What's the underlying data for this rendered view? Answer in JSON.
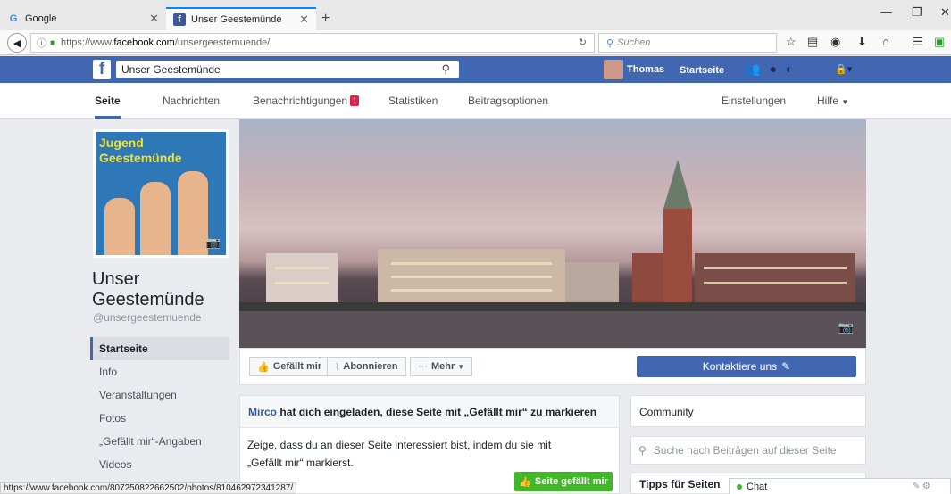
{
  "browser": {
    "tabs": [
      {
        "label": "Google",
        "icon": "google-icon",
        "active": false
      },
      {
        "label": "Unser Geestemünde",
        "icon": "facebook-icon",
        "active": true
      }
    ],
    "url_prefix": "https://www.",
    "url_domain": "facebook.com",
    "url_path": "/unsergeestemuende/",
    "search_placeholder": "Suchen",
    "status_url": "https://www.facebook.com/807250822662502/photos/810462972341287/"
  },
  "fb": {
    "search_value": "Unser Geestemünde",
    "user_name": "Thomas",
    "home_label": "Startseite"
  },
  "page_tabs": {
    "seite": "Seite",
    "nachrichten": "Nachrichten",
    "benachrichtigungen": "Benachrichtigungen",
    "benachrichtigungen_count": "1",
    "statistiken": "Statistiken",
    "beitragsoptionen": "Beitragsoptionen",
    "einstellungen": "Einstellungen",
    "hilfe": "Hilfe"
  },
  "profile": {
    "image_text_line1": "Jugend",
    "image_text_line2": "Geestemünde",
    "name_line1": "Unser",
    "name_line2": "Geestemünde",
    "handle": "@unsergeestemuende"
  },
  "left_nav": [
    {
      "label": "Startseite",
      "active": true
    },
    {
      "label": "Info",
      "active": false
    },
    {
      "label": "Veranstaltungen",
      "active": false
    },
    {
      "label": "Fotos",
      "active": false
    },
    {
      "label": "„Gefällt mir“-Angaben",
      "active": false
    },
    {
      "label": "Videos",
      "active": false
    }
  ],
  "actions": {
    "like": "Gefällt mir",
    "follow": "Abonnieren",
    "more": "Mehr",
    "contact": "Kontaktiere uns"
  },
  "invite": {
    "inviter": "Mirco",
    "header_rest": "hat dich eingeladen, diese Seite mit „Gefällt mir“ zu markieren",
    "body_line1": "Zeige, dass du an dieser Seite interessiert bist, indem du sie mit",
    "body_line2": "„Gefällt mir“ markierst.",
    "button": "Seite gefällt mir"
  },
  "right": {
    "community": "Community",
    "search_placeholder": "Suche nach Beiträgen auf dieser Seite",
    "tips": "Tipps für Seiten"
  },
  "chat": {
    "label": "Chat"
  },
  "colors": {
    "fb_blue": "#4267b2",
    "like_green": "#42b72a",
    "badge_red": "#e41e3f",
    "link_blue": "#365899"
  }
}
